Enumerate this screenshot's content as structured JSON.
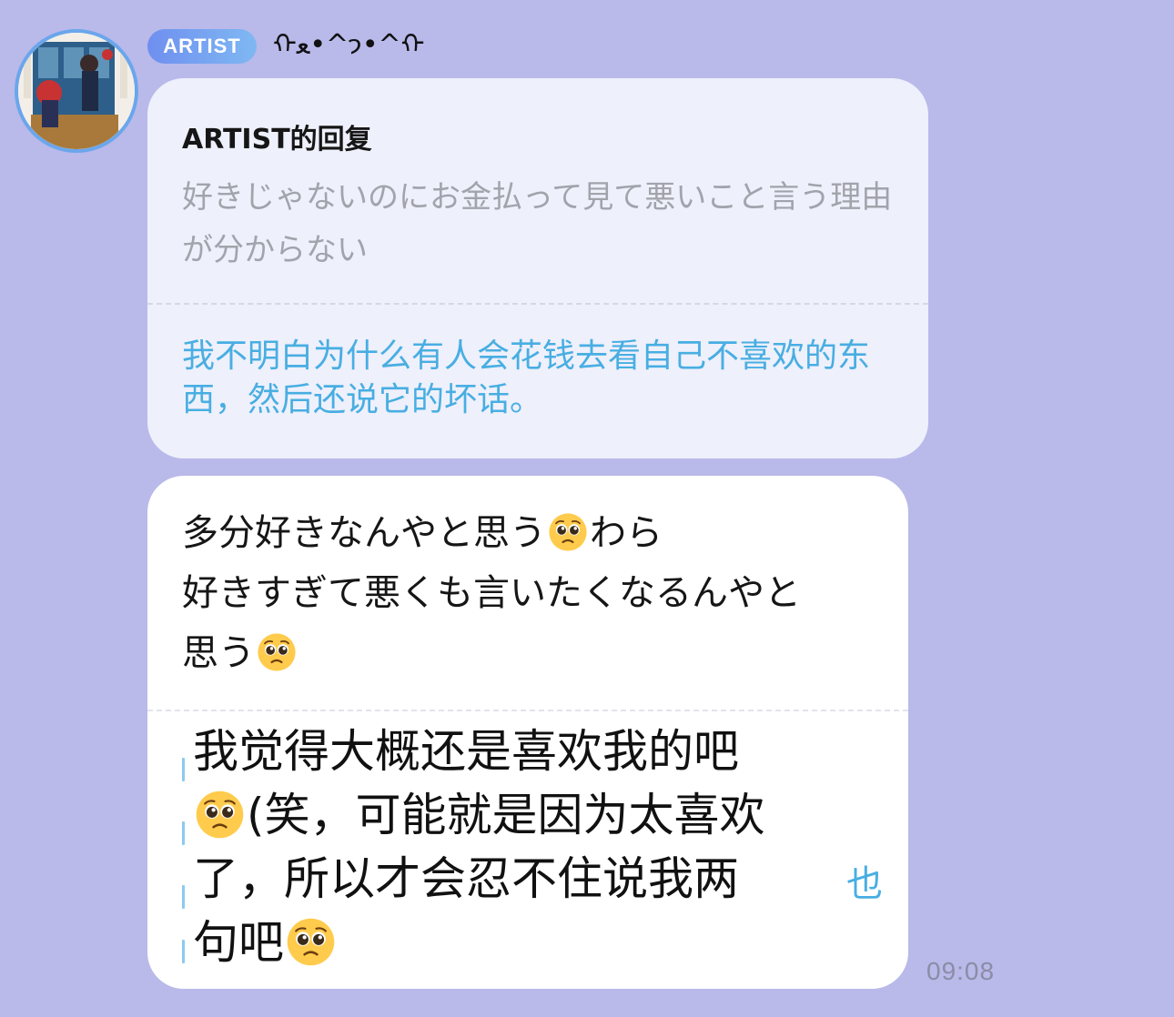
{
  "header": {
    "badge_label": "ARTIST",
    "username": "ᡣ𐭩^•ﻌ•^ᡣ"
  },
  "reply": {
    "title": "ARTIST的回复",
    "original_text": "好きじゃないのにお金払って見て悪いこと言う理由が分からない",
    "translation_text": "我不明白为什么有人会花钱去看自己不喜欢的东西，然后还说它的坏话。"
  },
  "message": {
    "original_line1_a": "多分好きなんやと思う",
    "original_line1_b": "わら",
    "original_line2": "好きすぎて悪くも言いたくなるんやと",
    "original_line3": "思う",
    "translation_line1": "我觉得大概还是喜欢我的吧",
    "translation_line2": "(笑，可能就是因为太喜欢",
    "translation_line3": "了，所以才会忍不住说我两",
    "translation_line4": "句吧",
    "translation_tail_char": "也"
  },
  "emoji": {
    "name": "pleading-face",
    "face_color": "#ffcb4c",
    "eye_color": "#3a2a1a"
  },
  "timestamp": "09:08",
  "colors": {
    "background": "#b9b9ea",
    "reply_bubble": "#eef0fb",
    "message_bubble": "#ffffff",
    "translation_text": "#48aee2",
    "badge_start": "#6f8ff0",
    "badge_end": "#7fb8f2",
    "avatar_border": "#6aa6ec"
  }
}
